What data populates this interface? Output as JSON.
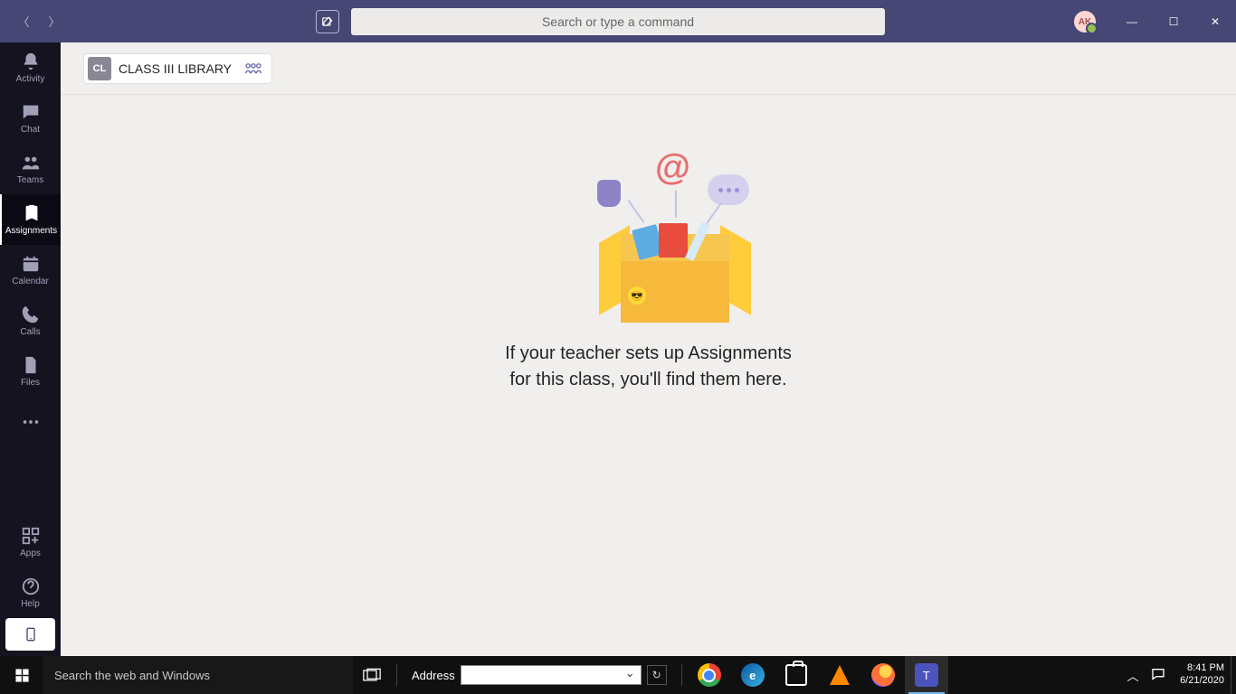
{
  "titlebar": {
    "search_placeholder": "Search or type a command",
    "avatar_initials": "AK"
  },
  "rail": {
    "activity": "Activity",
    "chat": "Chat",
    "teams": "Teams",
    "assignments": "Assignments",
    "calendar": "Calendar",
    "calls": "Calls",
    "files": "Files",
    "apps": "Apps",
    "help": "Help"
  },
  "class": {
    "badge": "CL",
    "name": "CLASS III LIBRARY"
  },
  "empty": {
    "line1": "If your teacher sets up Assignments",
    "line2": "for this class, you'll find them here."
  },
  "taskbar": {
    "search_placeholder": "Search the web and Windows",
    "address_label": "Address",
    "time": "8:41 PM",
    "date": "6/21/2020"
  }
}
